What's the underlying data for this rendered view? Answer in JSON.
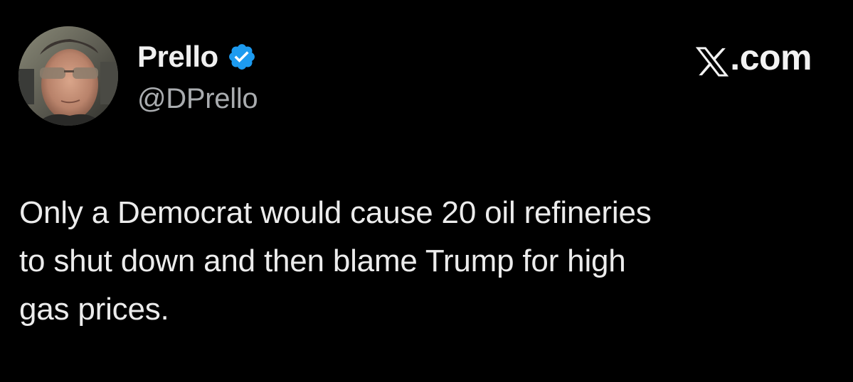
{
  "tweet": {
    "author": {
      "name": "Prello",
      "handle": "@DPrello",
      "verified": true,
      "avatar_icon": "profile-photo-man-sunglasses"
    },
    "source": {
      "brand_glyph": "𝕏",
      "label_suffix": ".com",
      "icon": "x-logo"
    },
    "text_lines": [
      "Only a Democrat would cause 20 oil refineries",
      "to shut down and then blame Trump for high",
      "gas prices."
    ]
  },
  "colors": {
    "background": "#000000",
    "text": "#e7e9ea",
    "handle": "#a9acaf",
    "verified_badge": "#1d9bf0"
  }
}
